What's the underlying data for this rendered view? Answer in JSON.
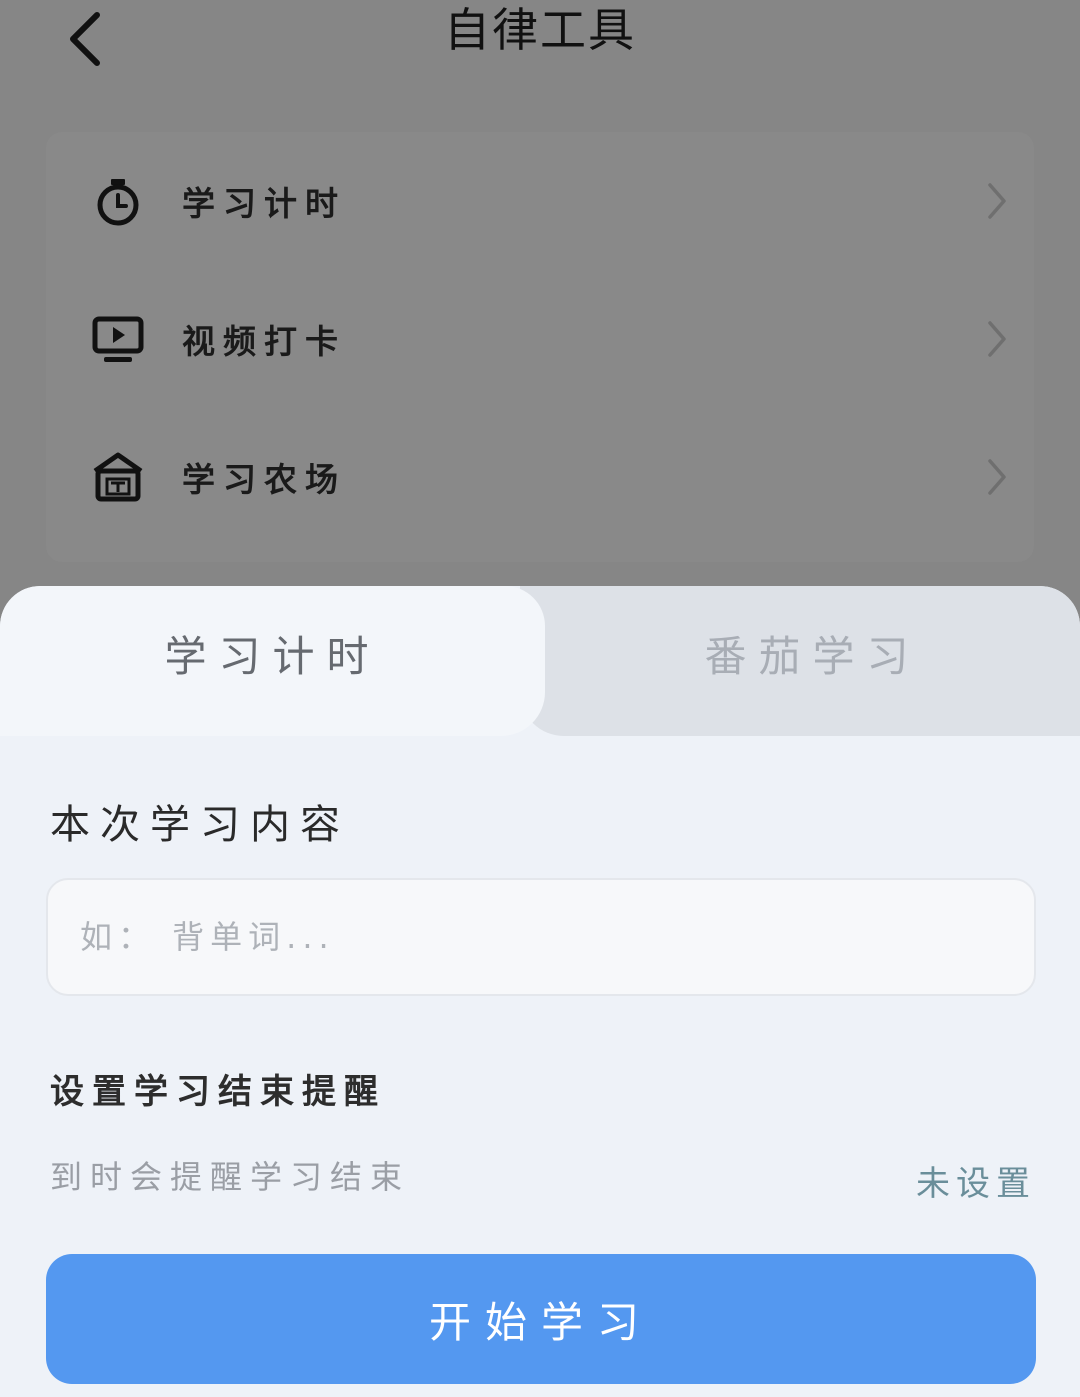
{
  "header": {
    "title": "自律工具",
    "back_icon": "chevron-left-icon"
  },
  "menu": {
    "items": [
      {
        "label": "学习计时",
        "icon": "stopwatch-icon"
      },
      {
        "label": "视频打卡",
        "icon": "video-play-icon"
      },
      {
        "label": "学习农场",
        "icon": "farm-house-icon"
      }
    ]
  },
  "sheet": {
    "tabs": [
      {
        "label": "学习计时",
        "active": true
      },
      {
        "label": "番茄学习",
        "active": false
      }
    ],
    "content_title": "本次学习内容",
    "input": {
      "placeholder": "如： 背单词...",
      "value": ""
    },
    "reminder": {
      "title": "设置学习结束提醒",
      "description": "到时会提醒学习结束",
      "value": "未设置"
    },
    "start_button_label": "开始学习"
  },
  "colors": {
    "overlay_dim": "#868686",
    "sheet_background": "#eef2f8",
    "primary_button": "#5498f0",
    "reminder_value": "#6a8e9a"
  }
}
